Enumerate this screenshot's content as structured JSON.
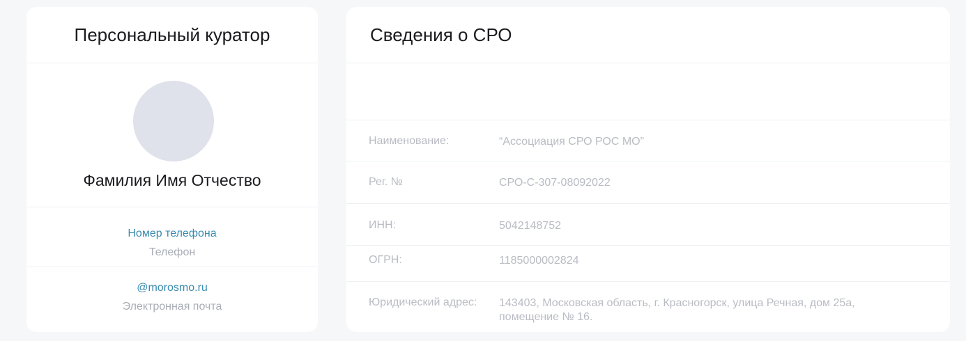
{
  "curator": {
    "title": "Персональный куратор",
    "name": "Фамилия Имя Отчество",
    "phone_value": "Номер телефона",
    "phone_label": "Телефон",
    "email_value": "@morosmo.ru",
    "email_label": "Электронная почта",
    "avatar_color": "#dfe2ea"
  },
  "sro": {
    "title": "Сведения о СРО",
    "rows": [
      {
        "label": "Наименование:",
        "value": "“Ассоциация СРО РОС МО”"
      },
      {
        "label": "Рег. №",
        "value": "СРО-С-307-08092022"
      },
      {
        "label": "ИНН:",
        "value": "5042148752"
      },
      {
        "label": "ОГРН:",
        "value": "1185000002824"
      },
      {
        "label": "Юридический адрес:",
        "value": "143403, Московская область, г. Красногорск, улица Речная, дом 25а, помещение № 16."
      }
    ]
  },
  "colors": {
    "background": "#f6f7f9",
    "card": "#ffffff",
    "link": "#3a8bb0",
    "muted": "#b9bcc3"
  }
}
